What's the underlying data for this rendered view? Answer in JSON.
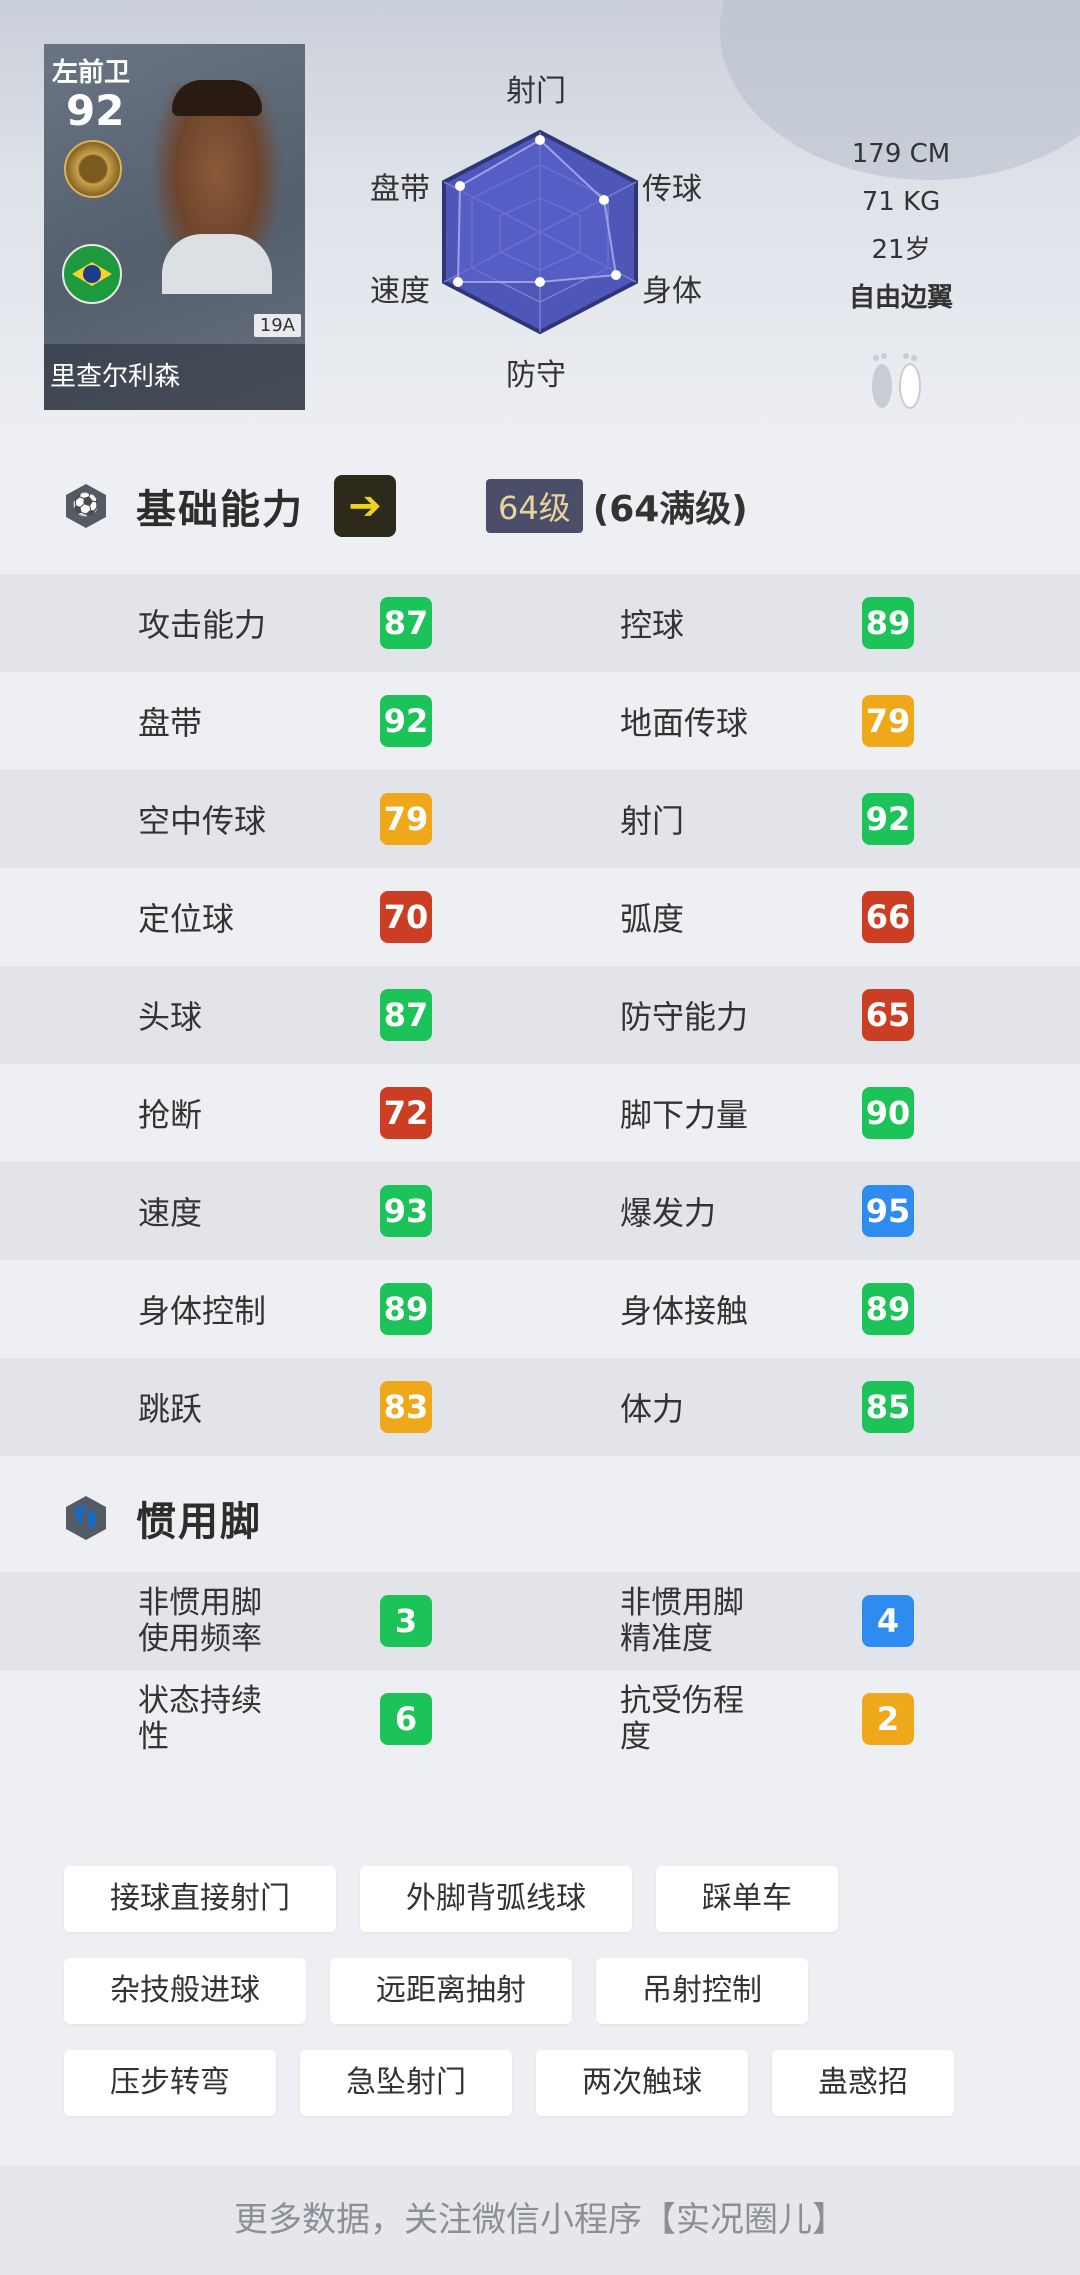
{
  "player": {
    "position": "左前卫",
    "overall": "92",
    "version": "19A",
    "name": "里查尔利森",
    "height": "179 CM",
    "weight": "71 KG",
    "age": "21岁",
    "role": "自由边翼"
  },
  "radar": {
    "labels": {
      "shooting": "射门",
      "passing": "传球",
      "physical": "身体",
      "defense": "防守",
      "speed": "速度",
      "dribbling": "盘带"
    }
  },
  "base_section": {
    "title": "基础能力",
    "level_badge": "64级",
    "level_text": "(64满级)"
  },
  "stats": [
    {
      "left_name": "攻击能力",
      "left_value": "87",
      "left_color": "green",
      "right_name": "控球",
      "right_value": "89",
      "right_color": "green"
    },
    {
      "left_name": "盘带",
      "left_value": "92",
      "left_color": "green",
      "right_name": "地面传球",
      "right_value": "79",
      "right_color": "yellow"
    },
    {
      "left_name": "空中传球",
      "left_value": "79",
      "left_color": "yellow",
      "right_name": "射门",
      "right_value": "92",
      "right_color": "green"
    },
    {
      "left_name": "定位球",
      "left_value": "70",
      "left_color": "red",
      "right_name": "弧度",
      "right_value": "66",
      "right_color": "red"
    },
    {
      "left_name": "头球",
      "left_value": "87",
      "left_color": "green",
      "right_name": "防守能力",
      "right_value": "65",
      "right_color": "red"
    },
    {
      "left_name": "抢断",
      "left_value": "72",
      "left_color": "red",
      "right_name": "脚下力量",
      "right_value": "90",
      "right_color": "green"
    },
    {
      "left_name": "速度",
      "left_value": "93",
      "left_color": "green",
      "right_name": "爆发力",
      "right_value": "95",
      "right_color": "blue"
    },
    {
      "left_name": "身体控制",
      "left_value": "89",
      "left_color": "green",
      "right_name": "身体接触",
      "right_value": "89",
      "right_color": "green"
    },
    {
      "left_name": "跳跃",
      "left_value": "83",
      "left_color": "yellow",
      "right_name": "体力",
      "right_value": "85",
      "right_color": "green"
    }
  ],
  "foot_section": {
    "title": "惯用脚",
    "rows": [
      {
        "left_name": "非惯用脚\n使用频率",
        "left_value": "3",
        "left_color": "green",
        "right_name": "非惯用脚\n精准度",
        "right_value": "4",
        "right_color": "blue"
      },
      {
        "left_name": "状态持续\n性",
        "left_value": "6",
        "left_color": "green",
        "right_name": "抗受伤程\n度",
        "right_value": "2",
        "right_color": "yellow"
      }
    ]
  },
  "skills": [
    [
      "接球直接射门",
      "外脚背弧线球",
      "踩单车"
    ],
    [
      "杂技般进球",
      "远距离抽射",
      "吊射控制"
    ],
    [
      "压步转弯",
      "急坠射门",
      "两次触球",
      "蛊惑招"
    ]
  ],
  "footer": "更多数据，关注微信小程序【实况圈儿】",
  "colors": {
    "green": "#1cc358",
    "yellow": "#f0a81b",
    "red": "#cc3e24",
    "blue": "#2e8cf0",
    "radar_fill": "#4e57b8"
  }
}
